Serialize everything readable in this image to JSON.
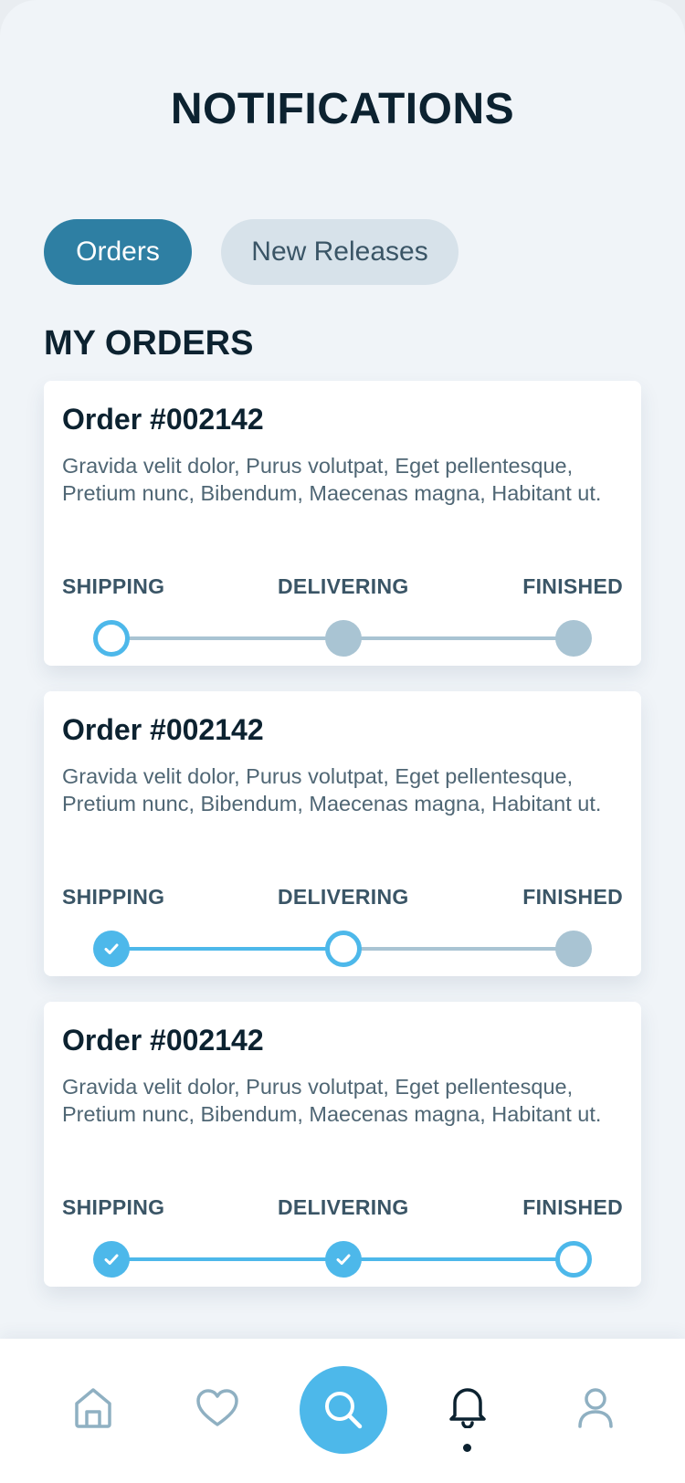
{
  "page": {
    "title": "NOTIFICATIONS"
  },
  "tabs": [
    {
      "label": "Orders",
      "active": true
    },
    {
      "label": "New Releases",
      "active": false
    }
  ],
  "section": {
    "title": "MY ORDERS"
  },
  "steps": {
    "shipping": "SHIPPING",
    "delivering": "DELIVERING",
    "finished": "FINISHED"
  },
  "orders": [
    {
      "title": "Order #002142",
      "description": "Gravida velit dolor,  Purus volutpat, Eget pellentesque, Pretium nunc, Bibendum, Maecenas magna, Habitant ut.",
      "status": "shipping",
      "step_states": [
        "current",
        "pending",
        "pending"
      ]
    },
    {
      "title": "Order #002142",
      "description": "Gravida velit dolor,  Purus volutpat, Eget pellentesque, Pretium nunc, Bibendum, Maecenas magna, Habitant ut.",
      "status": "delivering",
      "step_states": [
        "done",
        "current",
        "pending"
      ]
    },
    {
      "title": "Order #002142",
      "description": "Gravida velit dolor,  Purus volutpat, Eget pellentesque, Pretium nunc, Bibendum, Maecenas magna, Habitant ut.",
      "status": "finished",
      "step_states": [
        "done",
        "done",
        "current"
      ]
    }
  ],
  "bottom_nav": [
    {
      "icon": "home-icon",
      "active": false
    },
    {
      "icon": "heart-icon",
      "active": false
    },
    {
      "icon": "search-icon",
      "active": false
    },
    {
      "icon": "bell-icon",
      "active": true
    },
    {
      "icon": "user-icon",
      "active": false
    }
  ],
  "colors": {
    "accent": "#4db8ea",
    "tab_active": "#2e7fa3",
    "tab_inactive": "#d7e2ea",
    "step_pending": "#a9c4d3",
    "heading": "#0c2230",
    "background": "#f0f4f8"
  }
}
